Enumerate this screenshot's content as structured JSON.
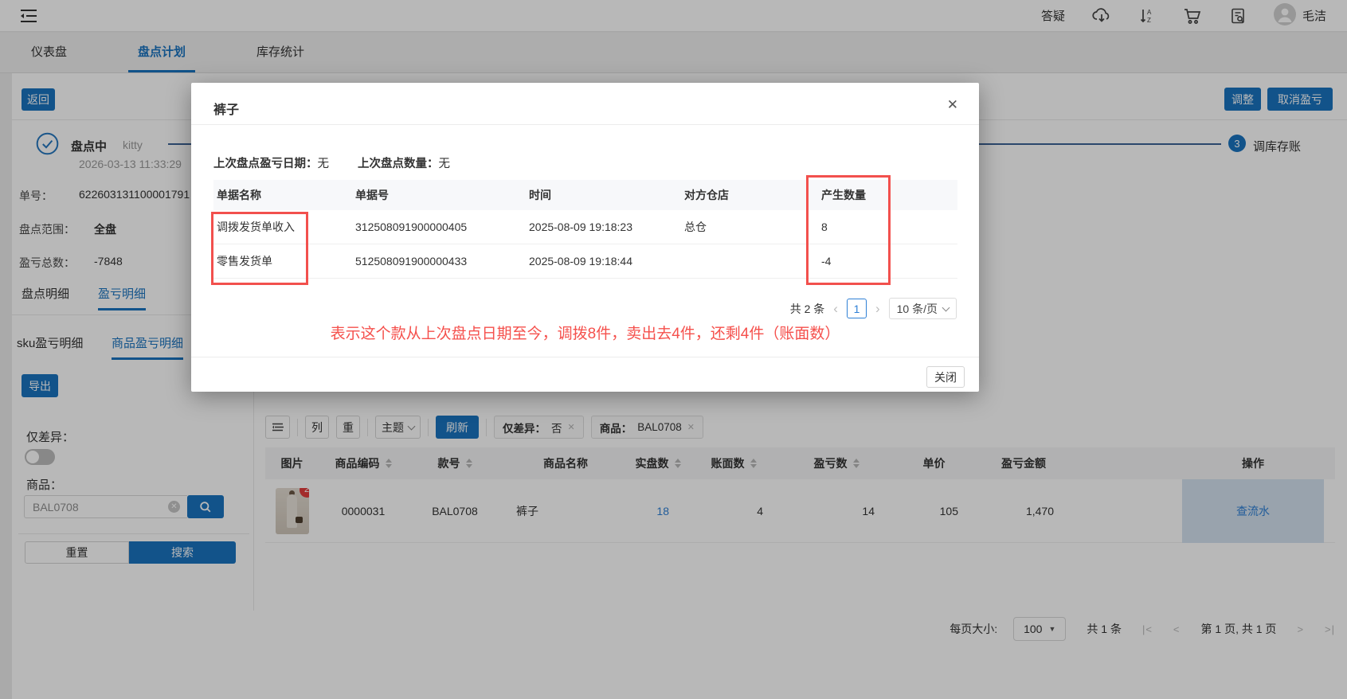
{
  "colors": {
    "primary": "#1a73c0",
    "annotation_red": "#f5504c",
    "link_blue": "#2f80d6"
  },
  "icons": {
    "close": "✕",
    "dismiss": "✕",
    "prev": "‹",
    "next": "›",
    "first": "|<",
    "prev_page": "<",
    "next_page": ">",
    "last": ">|"
  },
  "topbar": {
    "help": "答疑",
    "username": "毛洁"
  },
  "nav": {
    "tabs": [
      {
        "label": "仪表盘"
      },
      {
        "label": "盘点计划"
      },
      {
        "label": "库存统计"
      }
    ]
  },
  "actions": {
    "back": "返回",
    "adjust": "调整",
    "cancel_pl": "取消盈亏"
  },
  "plan": {
    "status": "盘点中",
    "operator": "kitty",
    "datetime": "2026-03-13 11:33:29",
    "step_num": "3",
    "step_label": "调库存账",
    "order_label": "单号：",
    "order_no": "622603131100001791",
    "scope_label": "盘点范围：",
    "scope": "全盘",
    "pl_total_label": "盈亏总数：",
    "pl_total": "-7848"
  },
  "detail_tabs": {
    "t1": "盘点明细",
    "t2": "盈亏明细"
  },
  "sub_tabs": {
    "t1": "sku盈亏明细",
    "t2": "商品盈亏明细"
  },
  "filter": {
    "export": "导出",
    "diff_label": "仅差异：",
    "product_label": "商品：",
    "product_value": "BAL0708",
    "reset": "重置",
    "search": "搜索"
  },
  "grid_toolbar": {
    "col": "列",
    "weight": "重",
    "theme": "主题",
    "refresh": "刷新",
    "tag1_label": "仅差异：",
    "tag1_value": "否",
    "tag2_label": "商品：",
    "tag2_value": "BAL0708"
  },
  "grid": {
    "headers": {
      "img": "图片",
      "code": "商品编码",
      "style": "款号",
      "name": "商品名称",
      "counted": "实盘数",
      "book": "账面数",
      "pl": "盈亏数",
      "price": "单价",
      "amount": "盈亏金额",
      "action": "操作"
    },
    "row": {
      "badge": "2",
      "code": "0000031",
      "style": "BAL0708",
      "name": "裤子",
      "counted": "18",
      "book": "4",
      "pl": "14",
      "price": "105",
      "amount": "1,470",
      "action": "查流水"
    }
  },
  "grid_pagination": {
    "size_label": "每页大小:",
    "size": "100",
    "total": "共 1 条",
    "page": "第 1 页, 共 1 页"
  },
  "modal": {
    "title": "裤子",
    "info": {
      "l1": "上次盘点盈亏日期：",
      "v1": "无",
      "l2": "上次盘点数量：",
      "v2": "无"
    },
    "table": {
      "headers": [
        "单据名称",
        "单据号",
        "时间",
        "对方仓店",
        "产生数量"
      ],
      "rows": [
        {
          "name": "调拨发货单收入",
          "no": "312508091900000405",
          "time": "2025-08-09 19:18:23",
          "store": "总仓",
          "qty": "8"
        },
        {
          "name": "零售发货单",
          "no": "512508091900000433",
          "time": "2025-08-09 19:18:44",
          "store": "",
          "qty": "-4"
        }
      ]
    },
    "pagination": {
      "total": "共 2 条",
      "page": "1",
      "size": "10 条/页"
    },
    "annotation": "表示这个款从上次盘点日期至今，调拨8件，卖出去4件，还剩4件（账面数）",
    "close": "关闭"
  }
}
